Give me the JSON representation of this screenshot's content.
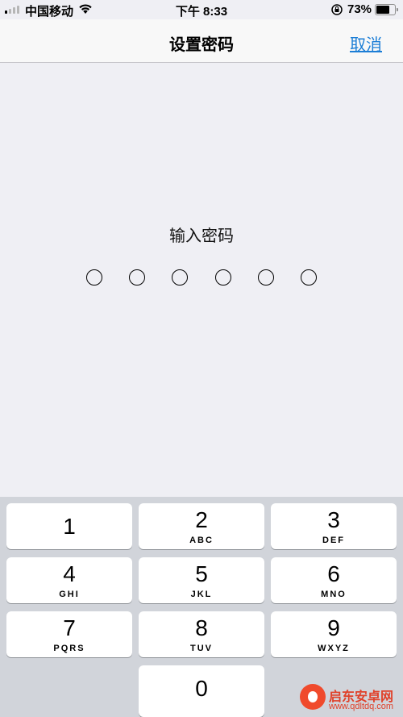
{
  "status_bar": {
    "carrier": "中国移动",
    "time": "下午 8:33",
    "battery_percent": "73%",
    "battery_level": 0.73,
    "signal_bars_filled": 1
  },
  "nav": {
    "title": "设置密码",
    "cancel": "取消"
  },
  "passcode": {
    "prompt": "输入密码",
    "digits_total": 6,
    "digits_entered": 0
  },
  "keypad": {
    "keys": [
      {
        "num": "1",
        "letters": ""
      },
      {
        "num": "2",
        "letters": "ABC"
      },
      {
        "num": "3",
        "letters": "DEF"
      },
      {
        "num": "4",
        "letters": "GHI"
      },
      {
        "num": "5",
        "letters": "JKL"
      },
      {
        "num": "6",
        "letters": "MNO"
      },
      {
        "num": "7",
        "letters": "PQRS"
      },
      {
        "num": "8",
        "letters": "TUV"
      },
      {
        "num": "9",
        "letters": "WXYZ"
      },
      {
        "num": "0",
        "letters": ""
      }
    ]
  },
  "watermark": {
    "name": "启东安卓网",
    "url": "www.qdltdq.com",
    "accent": "#e0412a"
  }
}
